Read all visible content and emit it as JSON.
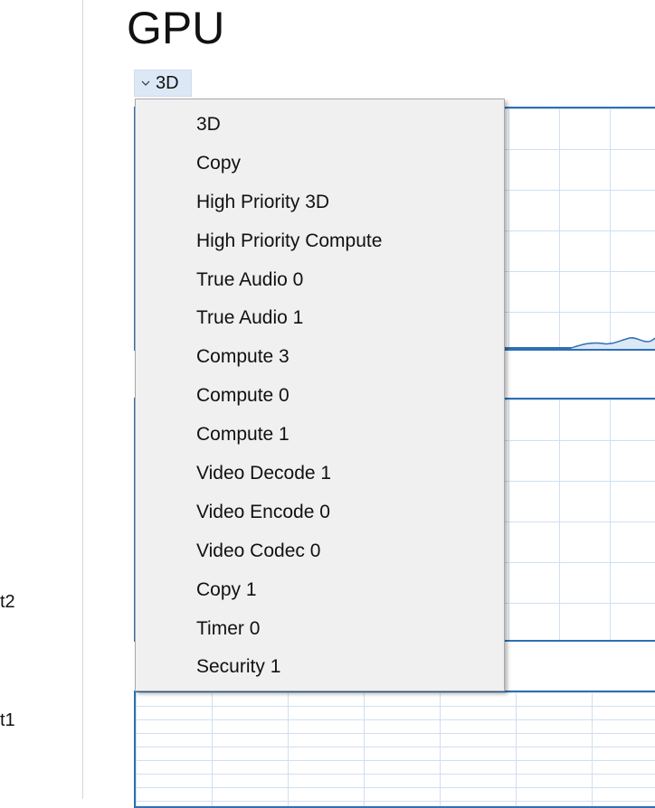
{
  "sidebar": {
    "items": [
      {
        "label": "t2"
      },
      {
        "label": "t1"
      }
    ]
  },
  "header": {
    "title": "GPU"
  },
  "engine_selector": {
    "selected": "3D",
    "options": [
      "3D",
      "Copy",
      "High Priority 3D",
      "High Priority Compute",
      "True Audio 0",
      "True Audio 1",
      "Compute 3",
      "Compute 0",
      "Compute 1",
      "Video Decode 1",
      "Video Encode 0",
      "Video Codec 0",
      "Copy 1",
      "Timer 0",
      "Security 1"
    ]
  },
  "colors": {
    "graph_border": "#2f6fb4",
    "graph_grid": "#cfe0f2",
    "dropdown_selected_bg": "#dce8f6",
    "menu_bg": "#f0f0f0"
  },
  "icons": {
    "dropdown": "chevron-down-icon"
  }
}
